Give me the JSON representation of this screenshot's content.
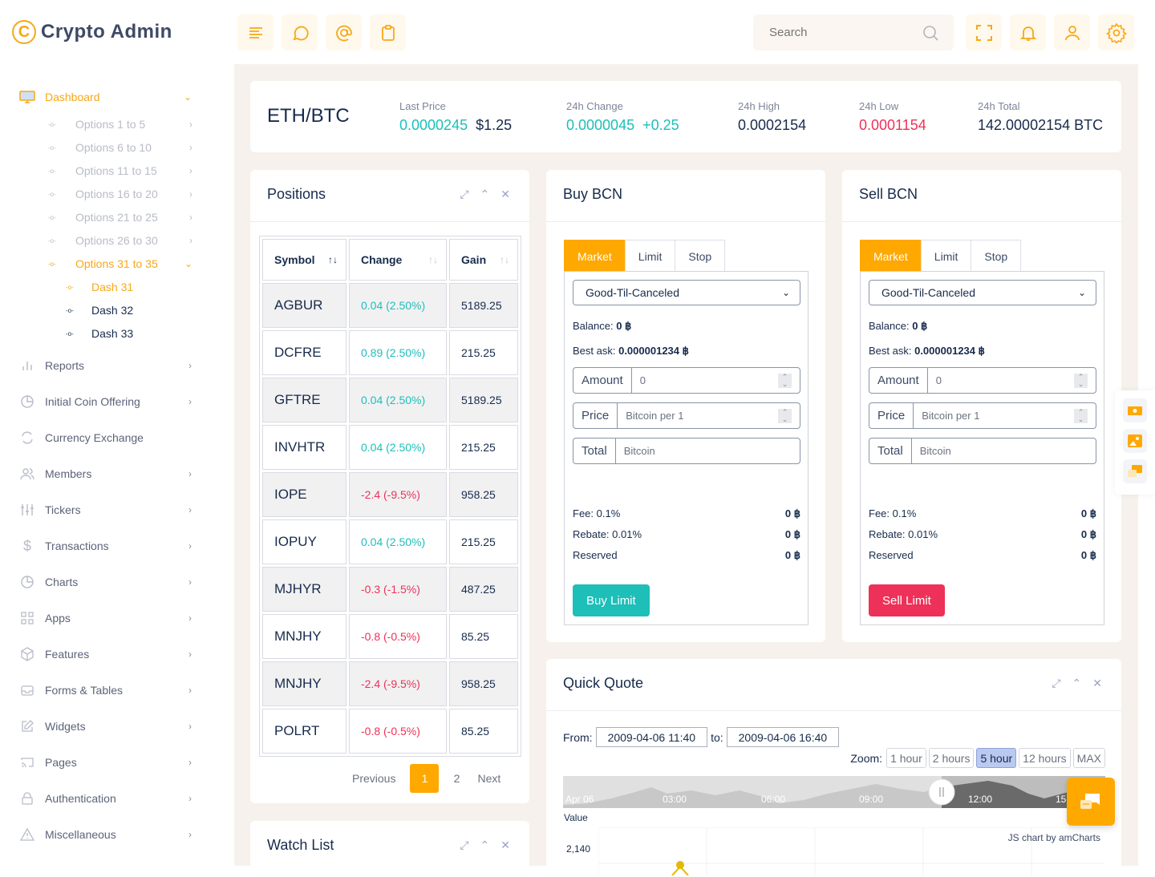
{
  "brand": {
    "name": "Crypto Admin",
    "logo_icon": "copyright-coin-icon"
  },
  "header": {
    "left_buttons": [
      {
        "name": "menu-toggle-button",
        "icon": "align-left-icon"
      },
      {
        "name": "chat-button",
        "icon": "message-circle-icon"
      },
      {
        "name": "mail-button",
        "icon": "at-sign-icon"
      },
      {
        "name": "clipboard-button",
        "icon": "clipboard-icon"
      }
    ],
    "search": {
      "placeholder": "Search",
      "icon": "search-icon"
    },
    "right_buttons": [
      {
        "name": "fullscreen-button",
        "icon": "maximize-icon"
      },
      {
        "name": "notifications-button",
        "icon": "bell-icon"
      },
      {
        "name": "user-button",
        "icon": "user-icon"
      },
      {
        "name": "settings-button",
        "icon": "gear-icon"
      }
    ]
  },
  "sidebar": {
    "dashboard": {
      "label": "Dashboard",
      "icon": "monitor-icon",
      "expanded": true
    },
    "dashboard_items": [
      {
        "label": "Options 1 to 5"
      },
      {
        "label": "Options 6 to 10"
      },
      {
        "label": "Options 11 to 15"
      },
      {
        "label": "Options 16 to 20"
      },
      {
        "label": "Options 21 to 25"
      },
      {
        "label": "Options 26 to 30"
      },
      {
        "label": "Options 31 to 35"
      }
    ],
    "dash_items": [
      {
        "label": "Dash 31"
      },
      {
        "label": "Dash 32"
      },
      {
        "label": "Dash 33"
      }
    ],
    "items": [
      {
        "label": "Reports",
        "icon": "bar-chart-icon",
        "chevron": true
      },
      {
        "label": "Initial Coin Offering",
        "icon": "pie-chart-icon",
        "chevron": true
      },
      {
        "label": "Currency Exchange",
        "icon": "refresh-icon",
        "chevron": false
      },
      {
        "label": "Members",
        "icon": "users-icon",
        "chevron": true
      },
      {
        "label": "Tickers",
        "icon": "sliders-icon",
        "chevron": true
      },
      {
        "label": "Transactions",
        "icon": "dollar-icon",
        "chevron": true
      },
      {
        "label": "Charts",
        "icon": "pie-chart-icon",
        "chevron": true
      },
      {
        "label": "Apps",
        "icon": "grid-icon",
        "chevron": true
      },
      {
        "label": "Features",
        "icon": "package-icon",
        "chevron": true
      },
      {
        "label": "Forms & Tables",
        "icon": "inbox-icon",
        "chevron": true
      },
      {
        "label": "Widgets",
        "icon": "edit-icon",
        "chevron": true
      },
      {
        "label": "Pages",
        "icon": "cast-icon",
        "chevron": true
      },
      {
        "label": "Authentication",
        "icon": "lock-icon",
        "chevron": true
      },
      {
        "label": "Miscellaneous",
        "icon": "alert-triangle-icon",
        "chevron": true
      }
    ]
  },
  "ticker": {
    "pair": "ETH/BTC",
    "last_price_label": "Last Price",
    "last_price": "0.0000245",
    "last_price_usd": "$1.25",
    "change_label": "24h Change",
    "change": "0.0000045",
    "change_delta": "+0.25",
    "high_label": "24h High",
    "high": "0.0002154",
    "low_label": "24h Low",
    "low": "0.0001154",
    "total_label": "24h Total",
    "total": "142.00002154 BTC"
  },
  "positions": {
    "title": "Positions",
    "columns": [
      "Symbol",
      "Change",
      "Gain"
    ],
    "rows": [
      {
        "symbol": "AGBUR",
        "change": "0.04 (2.50%)",
        "gain": "5189.25",
        "dir": "up"
      },
      {
        "symbol": "DCFRE",
        "change": "0.89 (2.50%)",
        "gain": "215.25",
        "dir": "up"
      },
      {
        "symbol": "GFTRE",
        "change": "0.04 (2.50%)",
        "gain": "5189.25",
        "dir": "up"
      },
      {
        "symbol": "INVHTR",
        "change": "0.04 (2.50%)",
        "gain": "215.25",
        "dir": "up"
      },
      {
        "symbol": "IOPE",
        "change": "-2.4 (-9.5%)",
        "gain": "958.25",
        "dir": "down"
      },
      {
        "symbol": "IOPUY",
        "change": "0.04 (2.50%)",
        "gain": "215.25",
        "dir": "up"
      },
      {
        "symbol": "MJHYR",
        "change": "-0.3 (-1.5%)",
        "gain": "487.25",
        "dir": "down"
      },
      {
        "symbol": "MNJHY",
        "change": "-0.8 (-0.5%)",
        "gain": "85.25",
        "dir": "down"
      },
      {
        "symbol": "MNJHY",
        "change": "-2.4 (-9.5%)",
        "gain": "958.25",
        "dir": "down"
      },
      {
        "symbol": "POLRT",
        "change": "-0.8 (-0.5%)",
        "gain": "85.25",
        "dir": "down"
      }
    ],
    "pager": {
      "previous": "Previous",
      "pages": [
        "1",
        "2"
      ],
      "current": "1",
      "next": "Next"
    }
  },
  "buy": {
    "title": "Buy BCN",
    "tabs": [
      "Market",
      "Limit",
      "Stop"
    ],
    "active_tab": "Market",
    "order_type": "Good-Til-Canceled",
    "balance_label": "Balance:",
    "balance": "0 ฿",
    "best_ask_label": "Best ask:",
    "best_ask": "0.000001234 ฿",
    "amount_label": "Amount",
    "amount_value": "0",
    "price_label": "Price",
    "price_placeholder": "Bitcoin per 1",
    "total_label": "Total",
    "total_placeholder": "Bitcoin",
    "fee_label": "Fee: 0.1%",
    "fee": "0 ฿",
    "rebate_label": "Rebate: 0.01%",
    "rebate": "0 ฿",
    "reserved_label": "Reserved",
    "reserved": "0 ฿",
    "button": "Buy Limit"
  },
  "sell": {
    "title": "Sell BCN",
    "tabs": [
      "Market",
      "Limit",
      "Stop"
    ],
    "active_tab": "Market",
    "order_type": "Good-Til-Canceled",
    "balance_label": "Balance:",
    "balance": "0 ฿",
    "best_ask_label": "Best ask:",
    "best_ask": "0.000001234 ฿",
    "amount_label": "Amount",
    "amount_value": "0",
    "price_label": "Price",
    "price_placeholder": "Bitcoin per 1",
    "total_label": "Total",
    "total_placeholder": "Bitcoin",
    "fee_label": "Fee: 0.1%",
    "fee": "0 ฿",
    "rebate_label": "Rebate: 0.01%",
    "rebate": "0 ฿",
    "reserved_label": "Reserved",
    "reserved": "0 ฿",
    "button": "Sell Limit"
  },
  "quick_quote": {
    "title": "Quick Quote",
    "from_label": "From:",
    "from": "2009-04-06 11:40",
    "to_label": "to:",
    "to": "2009-04-06 16:40",
    "zoom_label": "Zoom:",
    "zoom_options": [
      "1 hour",
      "2 hours",
      "5 hour",
      "12 hours",
      "MAX"
    ],
    "zoom_active": "5 hour",
    "scroll_labels": [
      "Apr 06",
      "03:00",
      "06:00",
      "09:00",
      "12:00",
      "15:"
    ],
    "value_label": "Value",
    "y_tick": "2,140",
    "credit": "JS chart by amCharts"
  },
  "watch_list": {
    "title": "Watch List"
  },
  "colors": {
    "accent": "#ffa800",
    "teal": "#1dbfb8",
    "red": "#ee3158",
    "text": "#172b4c"
  }
}
